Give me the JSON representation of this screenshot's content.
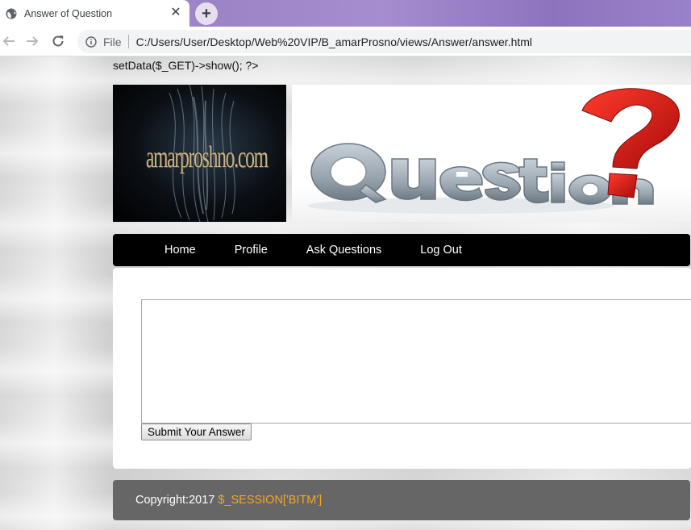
{
  "browser": {
    "tab": {
      "title": "Answer of Question",
      "favicon": "globe-icon",
      "close_glyph": "✕"
    },
    "new_tab_glyph": "+",
    "toolbar": {
      "back_icon": "back-arrow-icon",
      "forward_icon": "forward-arrow-icon",
      "reload_icon": "reload-icon",
      "info_icon": "info-icon",
      "scheme_label": "File",
      "url": "C:/Users/User/Desktop/Web%20VIP/B_amarProsno/views/Answer/answer.html"
    }
  },
  "page": {
    "php_leak_text": "setData($_GET)->show(); ?>",
    "banner": {
      "logo_text": "amarproshno.com",
      "question_image": "question-banner-image"
    },
    "nav": {
      "items": [
        {
          "label": "Home"
        },
        {
          "label": "Profile"
        },
        {
          "label": "Ask Questions"
        },
        {
          "label": "Log Out"
        }
      ]
    },
    "answer_form": {
      "textarea_value": "",
      "submit_label": "Submit Your Answer"
    },
    "footer": {
      "text": "Copyright:2017",
      "session_var": "$_SESSION['BITM']"
    }
  },
  "colors": {
    "tabstrip_accent": "#9c83c6",
    "navbar_bg": "#000000",
    "footer_bg": "#666666",
    "footer_var": "#f5a623"
  }
}
